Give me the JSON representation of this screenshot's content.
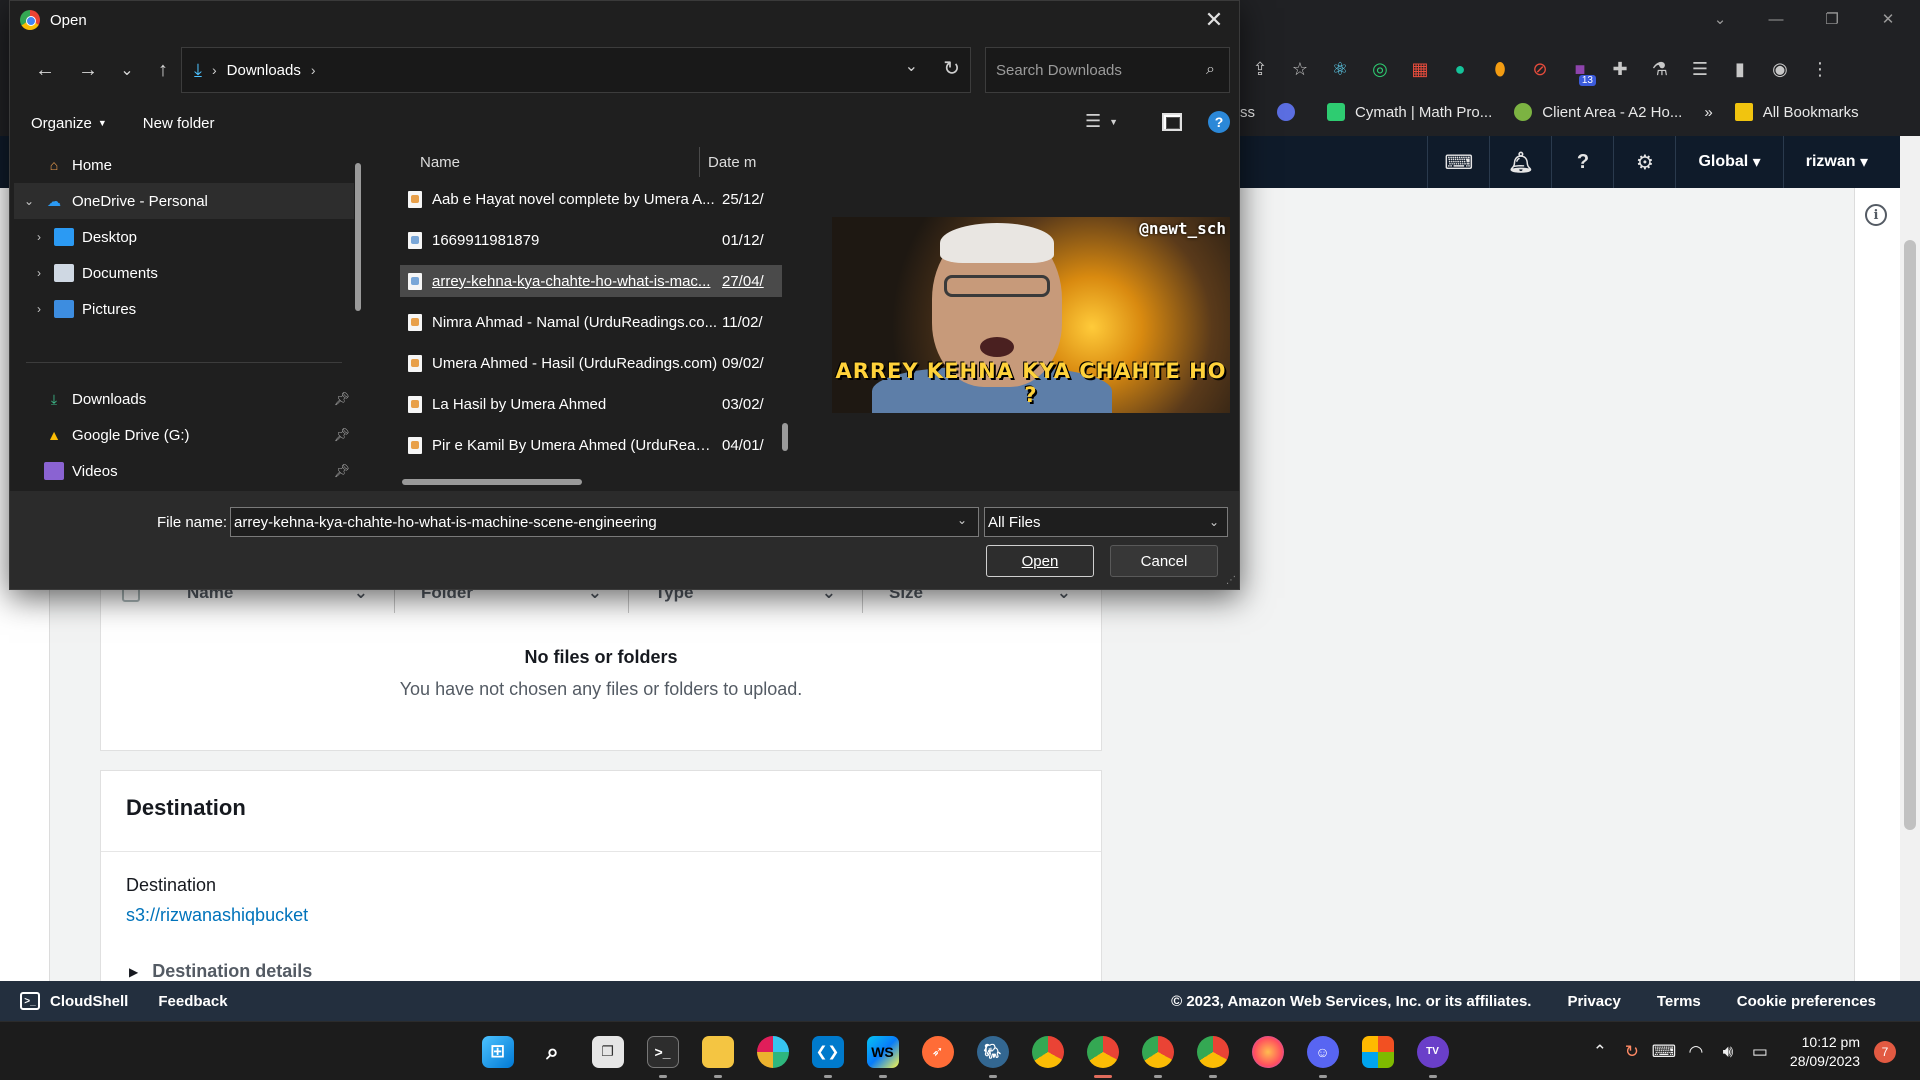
{
  "dialog": {
    "title": "Open",
    "address": {
      "segment": "Downloads"
    },
    "search_placeholder": "Search Downloads",
    "commands": {
      "organize": "Organize",
      "new_folder": "New folder"
    },
    "nav": [
      {
        "label": "Home"
      },
      {
        "label": "OneDrive - Personal"
      },
      {
        "label": "Desktop"
      },
      {
        "label": "Documents"
      },
      {
        "label": "Pictures"
      },
      {
        "label": "Downloads"
      },
      {
        "label": "Google Drive (G:)"
      },
      {
        "label": "Videos"
      }
    ],
    "columns": {
      "name": "Name",
      "date": "Date m"
    },
    "files": [
      {
        "name": "Aab e Hayat novel complete by Umera A...",
        "date": "25/12/"
      },
      {
        "name": "1669911981879",
        "date": "01/12/"
      },
      {
        "name": "arrey-kehna-kya-chahte-ho-what-is-mac...",
        "date": "27/04/"
      },
      {
        "name": "Nimra Ahmad - Namal (UrduReadings.co...",
        "date": "11/02/"
      },
      {
        "name": "Umera Ahmed - Hasil (UrduReadings.com)",
        "date": "09/02/"
      },
      {
        "name": "La Hasil by Umera Ahmed",
        "date": "03/02/"
      },
      {
        "name": "Pir e Kamil By Umera Ahmed (UrduReadi...",
        "date": "04/01/"
      }
    ],
    "preview": {
      "watermark": "@newt_sch",
      "caption": "ARREY KEHNA KYA CHAHTE HO ?"
    },
    "file_name_label": "File name:",
    "file_name_value": "arrey-kehna-kya-chahte-ho-what-is-machine-scene-engineering",
    "file_type": "All Files",
    "open_label": "Open",
    "cancel_label": "Cancel"
  },
  "browser": {
    "bookmarks": [
      {
        "label": "ss"
      },
      {
        "label": "Cymath | Math Pro..."
      },
      {
        "label": "Client Area - A2 Ho..."
      },
      {
        "label": "»"
      },
      {
        "label": "All Bookmarks"
      }
    ],
    "extension_badge": "13"
  },
  "aws": {
    "header": {
      "region": "Global",
      "user": "rizwan"
    },
    "table_columns": [
      "Name",
      "Folder",
      "Type",
      "Size"
    ],
    "empty_title": "No files or folders",
    "empty_desc": "You have not chosen any files or folders to upload.",
    "destination": {
      "heading": "Destination",
      "label": "Destination",
      "link": "s3://rizwanashiqbucket",
      "details": "Destination details"
    },
    "footer": {
      "cloudshell": "CloudShell",
      "feedback": "Feedback",
      "copyright": "© 2023, Amazon Web Services, Inc. or its affiliates.",
      "privacy": "Privacy",
      "terms": "Terms",
      "cookies": "Cookie preferences"
    }
  },
  "taskbar": {
    "time": "10:12 pm",
    "date": "28/09/2023",
    "notifications": "7",
    "ws_label": "WS"
  }
}
